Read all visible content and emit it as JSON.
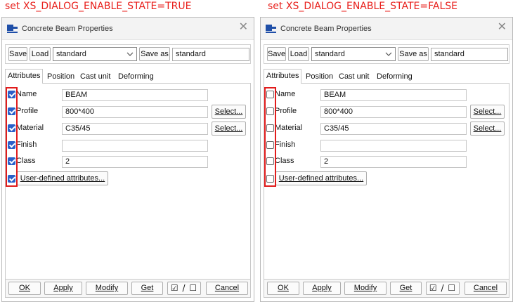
{
  "captions": {
    "left": "set XS_DIALOG_ENABLE_STATE=TRUE",
    "right": "set XS_DIALOG_ENABLE_STATE=FALSE"
  },
  "dialogs": [
    {
      "title": "Concrete Beam Properties",
      "close": "✕",
      "toolbar": {
        "save_label": "Save",
        "load_label": "Load",
        "load_value": "standard",
        "save_as_label": "Save as",
        "save_as_value": "standard"
      },
      "tabs": [
        "Attributes",
        "Position",
        "Cast unit",
        "Deforming"
      ],
      "fields": [
        {
          "label": "Name",
          "value": "BEAM",
          "checked": true
        },
        {
          "label": "Profile",
          "value": "800*400",
          "checked": true,
          "select_label": "Select..."
        },
        {
          "label": "Material",
          "value": "C35/45",
          "checked": true,
          "select_label": "Select..."
        },
        {
          "label": "Finish",
          "value": "",
          "checked": true
        },
        {
          "label": "Class",
          "value": "2",
          "checked": true
        }
      ],
      "user_defined": {
        "label": "User-defined attributes...",
        "checked": true
      },
      "bottom": {
        "ok": "OK",
        "apply": "Apply",
        "modify": "Modify",
        "get": "Get",
        "toggle": "☑ / ☐",
        "cancel": "Cancel"
      }
    },
    {
      "title": "Concrete Beam Properties",
      "close": "✕",
      "toolbar": {
        "save_label": "Save",
        "load_label": "Load",
        "load_value": "standard",
        "save_as_label": "Save as",
        "save_as_value": "standard"
      },
      "tabs": [
        "Attributes",
        "Position",
        "Cast unit",
        "Deforming"
      ],
      "fields": [
        {
          "label": "Name",
          "value": "BEAM",
          "checked": false
        },
        {
          "label": "Profile",
          "value": "800*400",
          "checked": false,
          "select_label": "Select..."
        },
        {
          "label": "Material",
          "value": "C35/45",
          "checked": false,
          "select_label": "Select..."
        },
        {
          "label": "Finish",
          "value": "",
          "checked": false
        },
        {
          "label": "Class",
          "value": "2",
          "checked": false
        }
      ],
      "user_defined": {
        "label": "User-defined attributes...",
        "checked": false
      },
      "bottom": {
        "ok": "OK",
        "apply": "Apply",
        "modify": "Modify",
        "get": "Get",
        "toggle": "☑ / ☐",
        "cancel": "Cancel"
      }
    }
  ],
  "colors": {
    "caption": "#e8201c",
    "checkbox_on": "#2a5fc9",
    "highlight": "#e11c1c"
  }
}
